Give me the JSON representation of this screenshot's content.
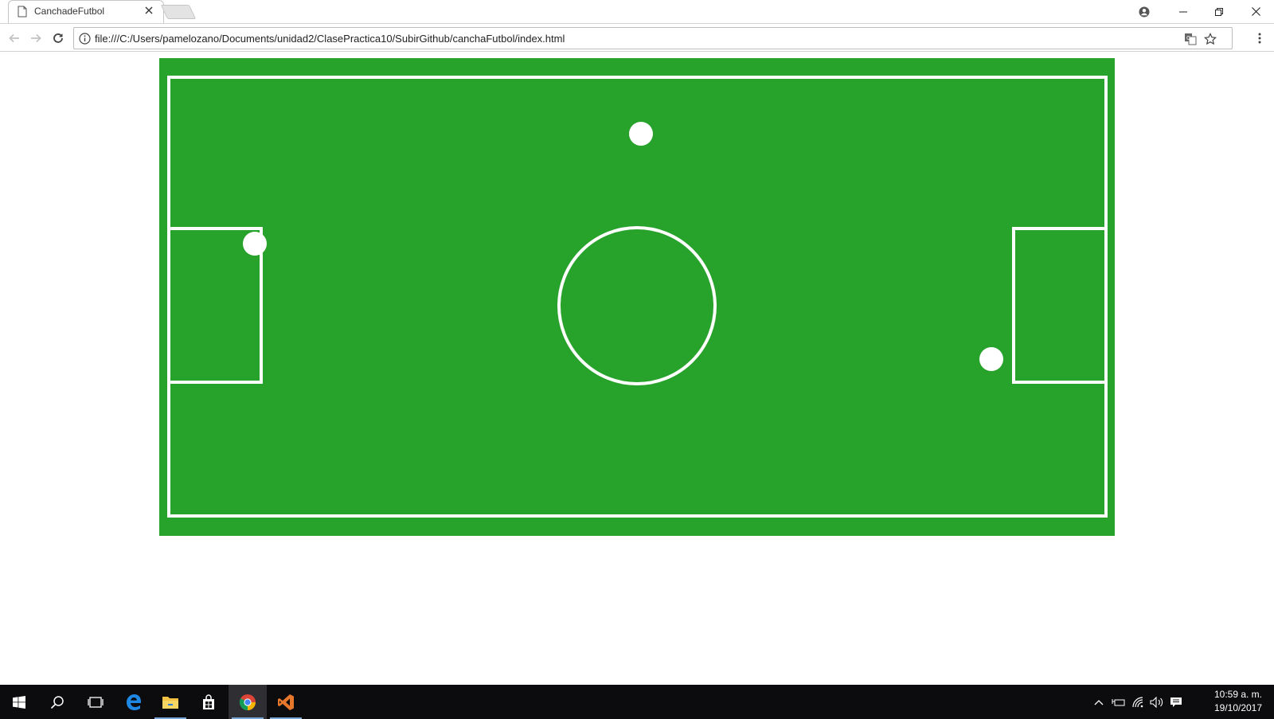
{
  "browser": {
    "tab": {
      "title": "CanchadeFutbol",
      "favicon": "page-icon",
      "close_icon": "close-icon"
    },
    "window_controls": [
      "account-icon",
      "minimize-icon",
      "restore-icon",
      "close-icon"
    ],
    "toolbar": {
      "back_icon": "back-arrow-icon",
      "forward_icon": "forward-arrow-icon",
      "reload_icon": "reload-icon",
      "address": "file:///C:/Users/pamelozano/Documents/unidad2/ClasePractica10/SubirGithub/canchaFutbol/index.html",
      "translate_icon": "translate-icon",
      "bookmark_icon": "star-icon",
      "menu_icon": "kebab-menu-icon"
    }
  },
  "page": {
    "colors": {
      "pitch": "#27a22b",
      "lines": "#ffffff",
      "ball": "#ffffff"
    },
    "balls_count": 3
  },
  "taskbar": {
    "items": [
      "windows-start-icon",
      "search-icon",
      "task-view-icon",
      "edge-icon",
      "file-explorer-icon",
      "store-icon",
      "chrome-icon",
      "visual-studio-icon"
    ],
    "clock": {
      "time": "10:59 a. m.",
      "date": "19/10/2017"
    },
    "tray": [
      "chevron-up-icon",
      "battery-icon",
      "wifi-icon",
      "volume-icon",
      "notification-icon"
    ]
  }
}
